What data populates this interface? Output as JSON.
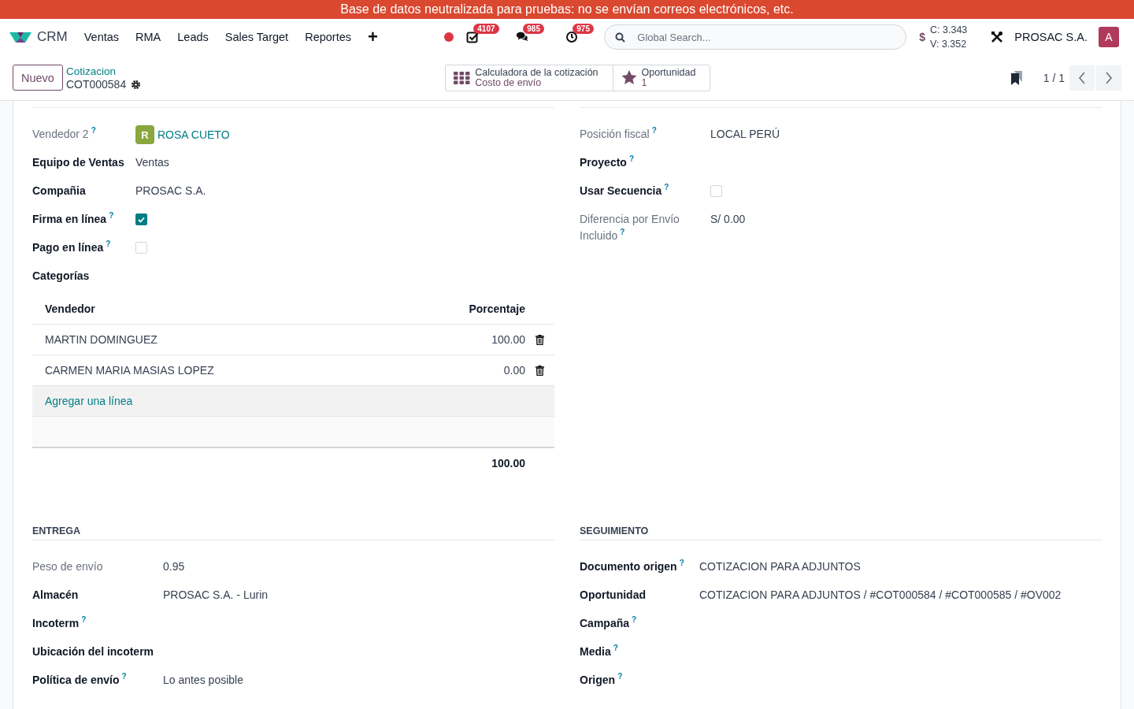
{
  "banner": "Base de datos neutralizada para pruebas: no se envían correos electrónicos, etc.",
  "navbar": {
    "brand": "CRM",
    "menus": [
      "Ventas",
      "RMA",
      "Leads",
      "Sales Target",
      "Reportes"
    ],
    "add": "+",
    "indicators": [
      {
        "kind": "activity",
        "count": "4107"
      },
      {
        "kind": "chat",
        "count": "985"
      },
      {
        "kind": "clock",
        "count": "975"
      }
    ],
    "search": {
      "placeholder": "Global Search..."
    },
    "currency": {
      "symbol": "$",
      "lines": [
        "C: 3.343",
        "V: 3.352"
      ]
    },
    "company": "PROSAC S.A.",
    "avatar": "A"
  },
  "control_panel": {
    "new_button": "Nuevo",
    "breadcrumb": "Cotizacion",
    "record": "COT000584",
    "smart_buttons": [
      {
        "kind": "grid",
        "label": "Calculadora de la cotización",
        "value": "Costo de envío"
      },
      {
        "kind": "star",
        "label": "Oportunidad",
        "value": "1"
      }
    ],
    "pager": "1 / 1"
  },
  "sections": [
    {
      "fields": [
        {
          "kind": "link",
          "label": "Vendedor 2",
          "help": "?",
          "readonly": true,
          "avatar": "R",
          "value": "ROSA CUETO"
        },
        {
          "kind": "text",
          "label": "Equipo de Ventas",
          "readonly": false,
          "value": "Ventas"
        },
        {
          "kind": "text",
          "label": "Compañia",
          "readonly": false,
          "value": "PROSAC S.A."
        },
        {
          "kind": "checkbox",
          "label": "Firma en línea",
          "help": "?",
          "readonly": false,
          "checked": true
        },
        {
          "kind": "checkbox",
          "label": "Pago en línea",
          "help": "?",
          "readonly": false,
          "checked": false
        },
        {
          "kind": "table",
          "label": "Categorías",
          "readonly": false,
          "columns": [
            "Vendedor",
            "Porcentaje"
          ],
          "rows": [
            {
              "vendedor": "MARTIN DOMINGUEZ",
              "porcentaje": "100.00"
            },
            {
              "vendedor": "CARMEN MARIA MASIAS LOPEZ",
              "porcentaje": "0.00"
            }
          ],
          "add_line": "Agregar una línea",
          "total": "100.00"
        }
      ]
    },
    {
      "fields": [
        {
          "kind": "text",
          "label": "Posición fiscal",
          "help": "?",
          "readonly": true,
          "value": "LOCAL PERÚ"
        },
        {
          "kind": "text",
          "label": "Proyecto",
          "help": "?",
          "readonly": false
        },
        {
          "kind": "checkbox",
          "label": "Usar Secuencia",
          "help": "?",
          "readonly": false,
          "checked": false
        },
        {
          "kind": "text",
          "label": "Diferencia por Envío Incluido",
          "help": "?",
          "readonly": true,
          "value": "S/ 0.00"
        }
      ]
    },
    {
      "title": "ENTREGA",
      "fields": [
        {
          "kind": "text",
          "label": "Peso de envío",
          "readonly": true,
          "value": "0.95"
        },
        {
          "kind": "text",
          "label": "Almacén",
          "readonly": false,
          "value": "PROSAC S.A. - Lurin"
        },
        {
          "kind": "text",
          "label": "Incoterm",
          "help": "?",
          "readonly": false
        },
        {
          "kind": "text",
          "label": "Ubicación del incoterm",
          "readonly": false
        },
        {
          "kind": "text",
          "label": "Política de envío",
          "help": "?",
          "readonly": false,
          "value": "Lo antes posible"
        }
      ]
    },
    {
      "title": "SEGUIMIENTO",
      "fields": [
        {
          "kind": "text",
          "label": "Documento origen",
          "help": "?",
          "readonly": false,
          "value": "COTIZACION PARA ADJUNTOS"
        },
        {
          "kind": "text",
          "label": "Oportunidad",
          "readonly": false,
          "value": "COTIZACION PARA ADJUNTOS / #COT000584 / #COT000585 / #OV002"
        },
        {
          "kind": "text",
          "label": "Campaña",
          "help": "?",
          "readonly": false
        },
        {
          "kind": "text",
          "label": "Media",
          "help": "?",
          "readonly": false
        },
        {
          "kind": "text",
          "label": "Origen",
          "help": "?",
          "readonly": false
        }
      ]
    }
  ]
}
